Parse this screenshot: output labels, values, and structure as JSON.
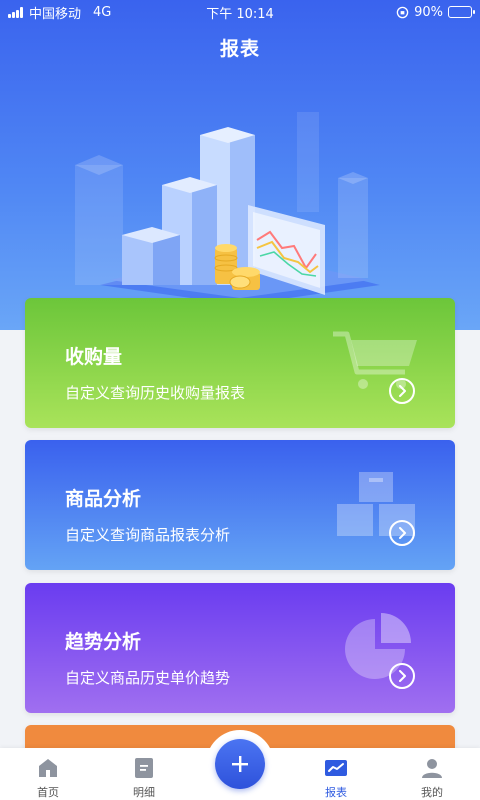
{
  "status_bar": {
    "carrier": "中国移动",
    "network": "4G",
    "time": "下午 10:14",
    "battery": "90%",
    "battery_level": 0.9
  },
  "header": {
    "title": "报表"
  },
  "cards": [
    {
      "title": "收购量",
      "subtitle": "自定义查询历史收购量报表",
      "icon": "shopping-cart-icon"
    },
    {
      "title": "商品分析",
      "subtitle": "自定义查询商品报表分析",
      "icon": "boxes-icon"
    },
    {
      "title": "趋势分析",
      "subtitle": "自定义商品历史单价趋势",
      "icon": "pie-chart-icon"
    }
  ],
  "tabbar": {
    "items": [
      {
        "label": "首页",
        "icon": "home-icon"
      },
      {
        "label": "明细",
        "icon": "document-icon"
      },
      {
        "label": "报表",
        "icon": "report-chart-icon",
        "active": true
      },
      {
        "label": "我的",
        "icon": "user-icon"
      }
    ],
    "fab_icon": "plus-icon"
  },
  "colors": {
    "primary": "#3a63ee",
    "card1": "#6cc63a",
    "card2": "#3a61ee",
    "card3": "#6a3cf0",
    "card4": "#f08a3e"
  }
}
